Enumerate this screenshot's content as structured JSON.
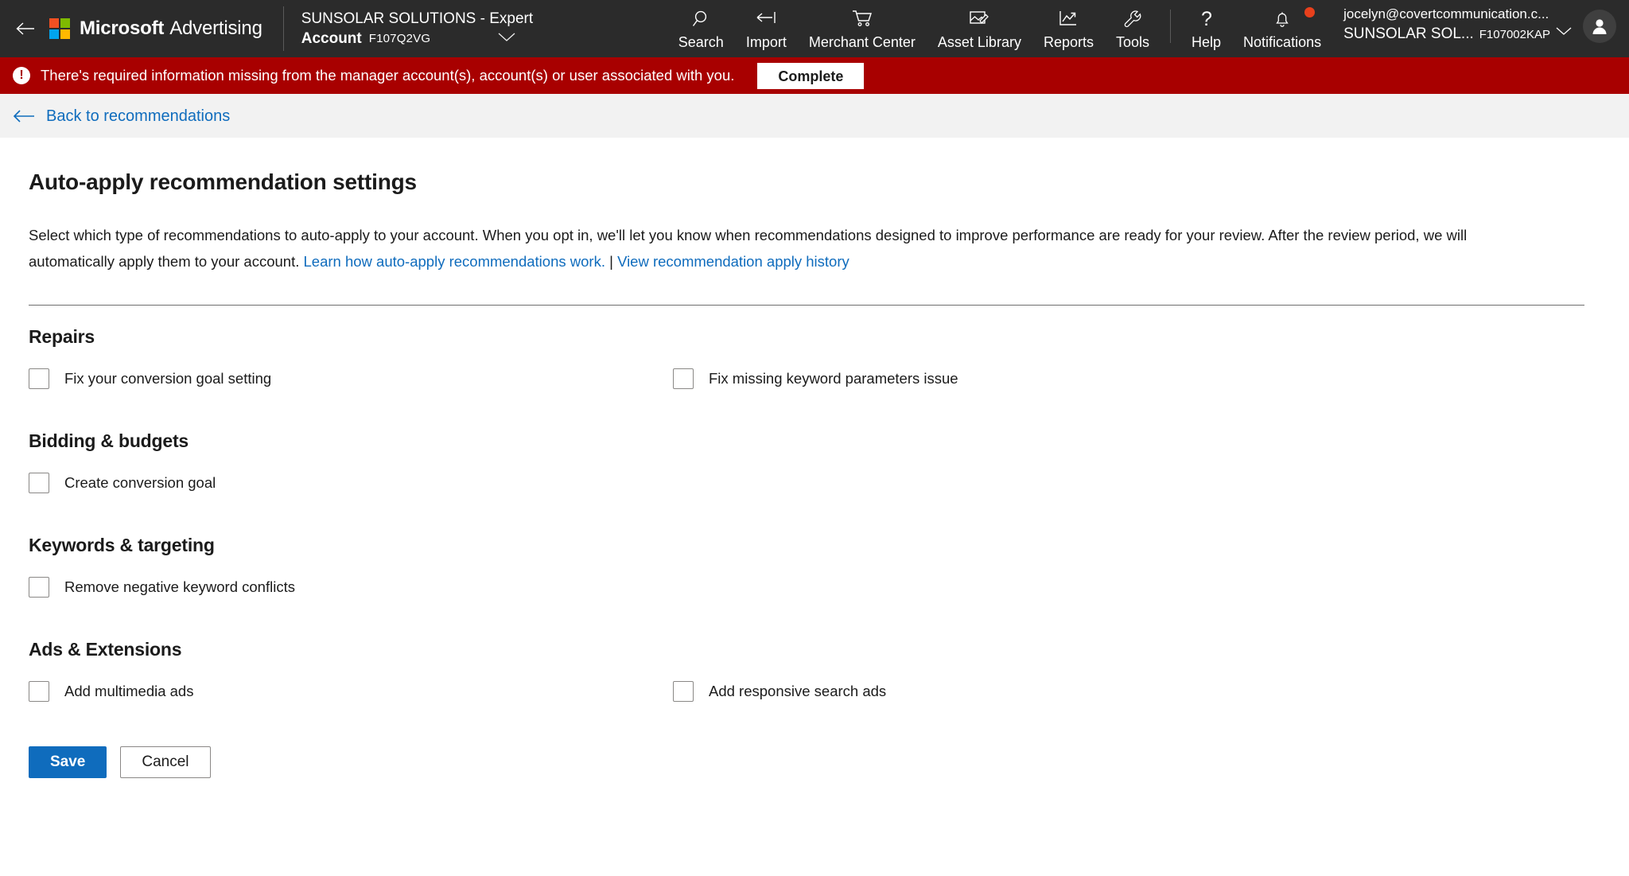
{
  "topnav": {
    "back_icon": "arrow-left-icon",
    "brand": {
      "name": "Microsoft",
      "product": "Advertising"
    },
    "logo_colors": [
      "#f25022",
      "#7fba00",
      "#00a4ef",
      "#ffb900"
    ],
    "account": {
      "title": "SUNSOLAR SOLUTIONS - Expert",
      "label": "Account",
      "id": "F107Q2VG"
    },
    "items": [
      {
        "label": "Search",
        "icon": "search-icon"
      },
      {
        "label": "Import",
        "icon": "import-arrow-icon"
      },
      {
        "label": "Merchant Center",
        "icon": "shopping-cart-icon"
      },
      {
        "label": "Asset Library",
        "icon": "image-edit-icon"
      },
      {
        "label": "Reports",
        "icon": "line-chart-icon"
      },
      {
        "label": "Tools",
        "icon": "wrench-icon"
      }
    ],
    "right_items": [
      {
        "label": "Help",
        "icon": "question-mark-icon"
      },
      {
        "label": "Notifications",
        "icon": "bell-icon",
        "has_badge": true
      }
    ],
    "user": {
      "email": "jocelyn@covertcommunication.c...",
      "account_name": "SUNSOLAR SOL...",
      "account_id": "F107002KAP",
      "avatar_icon": "person-icon"
    }
  },
  "alert": {
    "icon": "exclamation-icon",
    "glyph": "!",
    "message": "There's required information missing from the manager account(s), account(s) or user associated with you.",
    "button_label": "Complete",
    "color": "#a80000"
  },
  "breadcrumb": {
    "icon": "arrow-left-icon",
    "label": "Back to recommendations",
    "color": "#0f6cbd"
  },
  "main": {
    "title": "Auto-apply recommendation settings",
    "description_part1": "Select which type of recommendations to auto-apply to your account. When you opt in, we'll let you know when recommendations designed to improve performance are ready for your review. After the review period, we will automatically apply them to your account. ",
    "link_learn": "Learn how auto-apply recommendations work.",
    "link_separator": " | ",
    "link_history": "View recommendation apply history",
    "sections": [
      {
        "title": "Repairs",
        "options": [
          {
            "label": "Fix your conversion goal setting",
            "checked": false
          },
          {
            "label": "Fix missing keyword parameters issue",
            "checked": false
          }
        ]
      },
      {
        "title": "Bidding & budgets",
        "options": [
          {
            "label": "Create conversion goal",
            "checked": false
          }
        ]
      },
      {
        "title": "Keywords & targeting",
        "options": [
          {
            "label": "Remove negative keyword conflicts",
            "checked": false
          }
        ]
      },
      {
        "title": "Ads & Extensions",
        "options": [
          {
            "label": "Add multimedia ads",
            "checked": false
          },
          {
            "label": "Add responsive search ads",
            "checked": false
          }
        ]
      }
    ],
    "buttons": {
      "save": "Save",
      "cancel": "Cancel"
    }
  }
}
